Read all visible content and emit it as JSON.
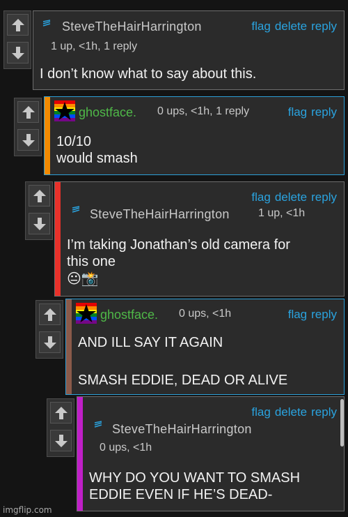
{
  "actions": {
    "flag": "flag",
    "delete": "delete",
    "reply": "reply"
  },
  "comments": [
    {
      "user": "SteveTheHairHarrington",
      "meta": "1 up, <1h, 1 reply",
      "text": "I don’t know what to say about this."
    },
    {
      "user": "ghostface.",
      "meta": "0 ups, <1h, 1 reply",
      "text1": "10/10",
      "text2": "would smash"
    },
    {
      "user": "SteveTheHairHarrington",
      "meta": "1 up, <1h",
      "text1": "I’m taking Jonathan’s old camera for",
      "text2": "this one",
      "emoji": "😐📸"
    },
    {
      "user": "ghostface.",
      "meta": "0 ups, <1h",
      "text1": "AND ILL SAY IT AGAIN",
      "text2": "SMASH EDDIE, DEAD OR ALIVE"
    },
    {
      "user": "SteveTheHairHarrington",
      "meta": "0 ups, <1h",
      "text1": "WHY DO YOU WANT TO SMASH",
      "text2": "EDDIE EVEN IF HE’S DEAD-"
    }
  ],
  "watermark": "imgflip.com",
  "colors": {
    "accent": "#2aa3df",
    "bar_orange": "#f18a00",
    "bar_red": "#e8312a",
    "bar_brown": "#8a5a4a",
    "bar_magenta": "#c01fc8"
  }
}
